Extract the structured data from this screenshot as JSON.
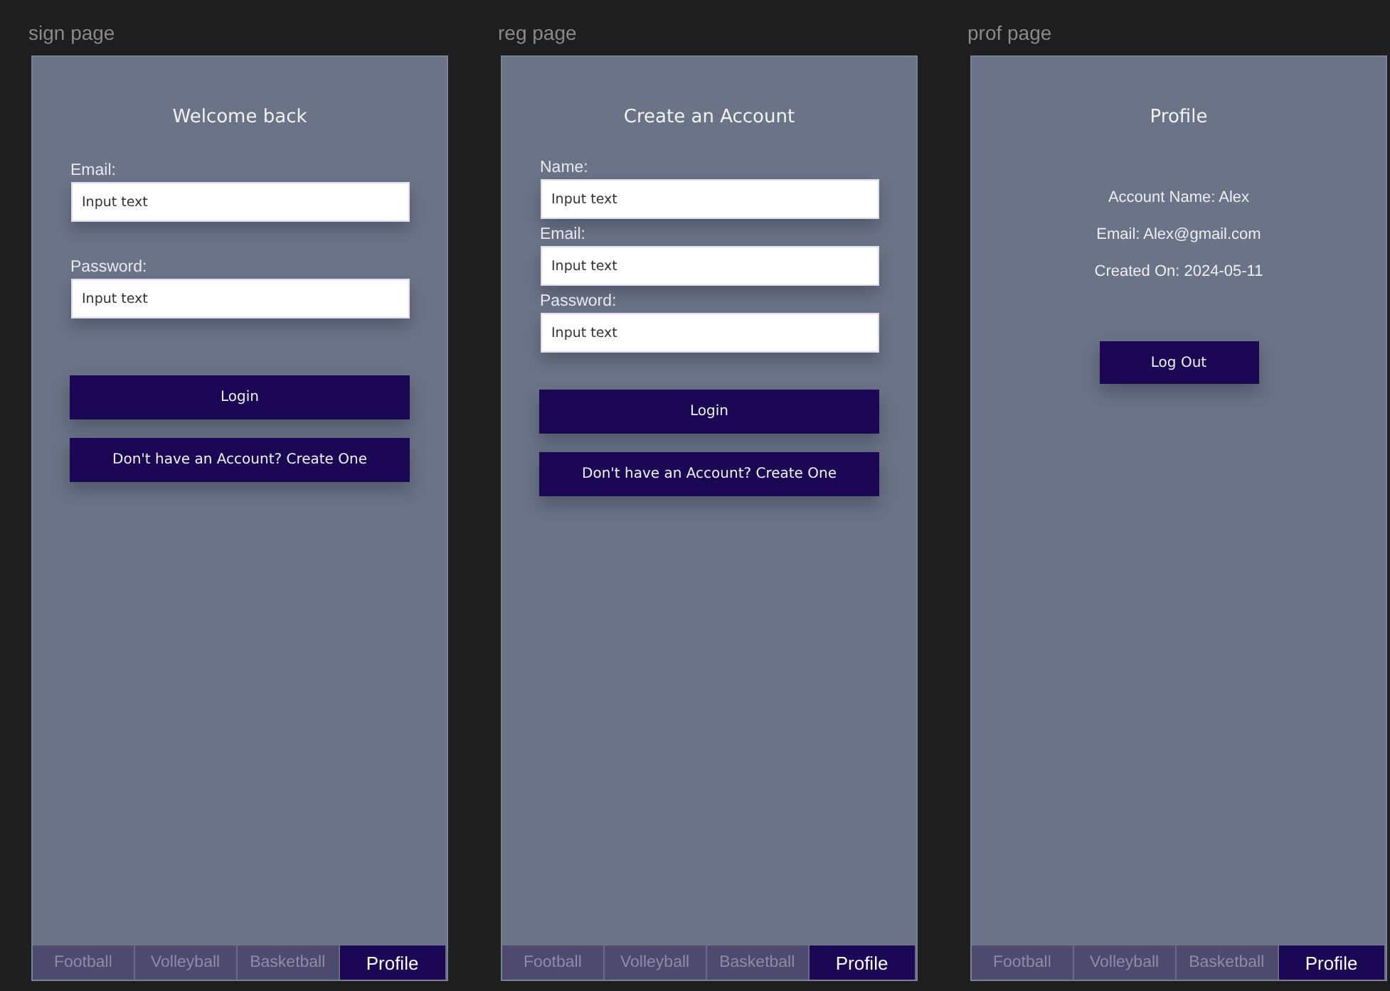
{
  "frames": [
    {
      "label": "sign page",
      "kind": "form",
      "title": "Welcome back",
      "fields": [
        {
          "label": "Email:",
          "placeholder": "Input text"
        },
        {
          "label": "Password:",
          "placeholder": "Input text"
        }
      ],
      "buttons": [
        "Login",
        "Don't have an Account? Create One"
      ],
      "tabs": [
        {
          "label": "Football",
          "selected": false
        },
        {
          "label": "Volleyball",
          "selected": false
        },
        {
          "label": "Basketball",
          "selected": false
        },
        {
          "label": "Profile",
          "selected": true
        }
      ]
    },
    {
      "label": "reg page",
      "kind": "form",
      "title": "Create an Account",
      "fields": [
        {
          "label": "Name:",
          "placeholder": "Input text"
        },
        {
          "label": "Email:",
          "placeholder": "Input text"
        },
        {
          "label": "Password:",
          "placeholder": "Input text"
        }
      ],
      "buttons": [
        "Login",
        "Don't have an Account? Create One"
      ],
      "tabs": [
        {
          "label": "Football",
          "selected": false
        },
        {
          "label": "Volleyball",
          "selected": false
        },
        {
          "label": "Basketball",
          "selected": false
        },
        {
          "label": "Profile",
          "selected": true
        }
      ]
    },
    {
      "label": "prof page",
      "kind": "profile",
      "title": "Profile",
      "lines": [
        "Account Name: Alex",
        "Email: Alex@gmail.com",
        "Created On: 2024-05-11"
      ],
      "buttons": [
        "Log Out"
      ],
      "tabs": [
        {
          "label": "Football",
          "selected": false
        },
        {
          "label": "Volleyball",
          "selected": false
        },
        {
          "label": "Basketball",
          "selected": false
        },
        {
          "label": "Profile",
          "selected": true
        }
      ]
    }
  ]
}
